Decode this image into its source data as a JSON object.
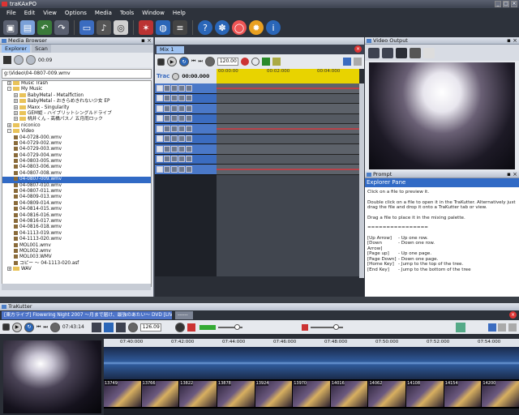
{
  "app": {
    "title": "traKAxPO"
  },
  "menu": [
    "File",
    "Edit",
    "View",
    "Options",
    "Media",
    "Tools",
    "Window",
    "Help"
  ],
  "media_browser": {
    "title": "Media Browser",
    "tabs": [
      "Explorer",
      "Scan"
    ],
    "time": "00:09",
    "path": "g:\\Video\\04-0807-009.wmv",
    "tree": [
      {
        "label": "Music Trash",
        "level": 1,
        "type": "folder",
        "expander": "+"
      },
      {
        "label": "My Music",
        "level": 1,
        "type": "folder",
        "expander": "-"
      },
      {
        "label": "BabyMetal - Metalfiction",
        "level": 2,
        "type": "folder",
        "expander": "+"
      },
      {
        "label": "BabyMetal - おきらめきれない少女 EP",
        "level": 2,
        "type": "folder",
        "expander": "+"
      },
      {
        "label": "Maxx - Singularity",
        "level": 2,
        "type": "folder",
        "expander": "+"
      },
      {
        "label": "GEM姫 - ハイブリットシングルドライブ",
        "level": 2,
        "type": "folder",
        "expander": "+"
      },
      {
        "label": "桃井くん - 高橋パスノ 五月雨ロック",
        "level": 2,
        "type": "folder",
        "expander": "+"
      },
      {
        "label": "niconico",
        "level": 1,
        "type": "folder",
        "expander": "+"
      },
      {
        "label": "Video",
        "level": 1,
        "type": "folder",
        "expander": "-"
      },
      {
        "label": "04-0728-000.wmv",
        "level": 2,
        "type": "file"
      },
      {
        "label": "04-0729-002.wmv",
        "level": 2,
        "type": "file"
      },
      {
        "label": "04-0729-003.wmv",
        "level": 2,
        "type": "file"
      },
      {
        "label": "04-0729-004.wmv",
        "level": 2,
        "type": "file"
      },
      {
        "label": "04-0803-005.wmv",
        "level": 2,
        "type": "file"
      },
      {
        "label": "04-0803-006.wmv",
        "level": 2,
        "type": "file"
      },
      {
        "label": "04-0807-008.wmv",
        "level": 2,
        "type": "file"
      },
      {
        "label": "04-0807-009.wmv",
        "level": 2,
        "type": "file",
        "selected": true
      },
      {
        "label": "04-0807-010.wmv",
        "level": 2,
        "type": "file"
      },
      {
        "label": "04-0807-011.wmv",
        "level": 2,
        "type": "file"
      },
      {
        "label": "04-0809-013.wmv",
        "level": 2,
        "type": "file"
      },
      {
        "label": "04-0809-014.wmv",
        "level": 2,
        "type": "file"
      },
      {
        "label": "04-0814-015.wmv",
        "level": 2,
        "type": "file"
      },
      {
        "label": "04-0816-016.wmv",
        "level": 2,
        "type": "file"
      },
      {
        "label": "04-0816-017.wmv",
        "level": 2,
        "type": "file"
      },
      {
        "label": "04-0816-018.wmv",
        "level": 2,
        "type": "file"
      },
      {
        "label": "04-1113-019.wmv",
        "level": 2,
        "type": "file"
      },
      {
        "label": "04-1113-020.wmv",
        "level": 2,
        "type": "file"
      },
      {
        "label": "MOL001.wmv",
        "level": 2,
        "type": "file"
      },
      {
        "label": "MOL002.wmv",
        "level": 2,
        "type": "file"
      },
      {
        "label": "MOL003.WMV",
        "level": 2,
        "type": "file"
      },
      {
        "label": "コピー ～ 04-1113-020.asf",
        "level": 2,
        "type": "file"
      },
      {
        "label": "WAV",
        "level": 1,
        "type": "folder",
        "expander": "+"
      }
    ]
  },
  "mixer": {
    "tab": "Mix 1",
    "bpm": "120.00",
    "track_label": "Trac",
    "time": "00:00.000",
    "ruler": [
      "00:00:00",
      "00:02:000",
      "00:04:000"
    ]
  },
  "video_output": {
    "title": "Video Output"
  },
  "prompt": {
    "title": "Prompt",
    "heading": "Explorer Pane",
    "p1": "Click on a file to preview it.",
    "p2": "Double click on a file to open it in the TraKutter. Alternatively just drag the file and drop it onto a TraKutter tab or view.",
    "p3": "Drag a file to place it in the mixing palette.",
    "divider": "================",
    "keys": [
      {
        "key": "[Up Arrow]",
        "desc": "- Up one row."
      },
      {
        "key": "[Down Arrow]",
        "desc": "- Down one row."
      },
      {
        "key": "[Page up]",
        "desc": "- Up one page."
      },
      {
        "key": "[Page Down]",
        "desc": "- Down one page."
      },
      {
        "key": "[Home Key]",
        "desc": "- Jump to the top of the tree."
      },
      {
        "key": "[End Key]",
        "desc": "- Jump to the bottom of the tree"
      }
    ]
  },
  "trakutter": {
    "title": "TraKutter",
    "tab1": "[東方ライブ] Flowering Night 2007 ～月まで届け、最強のあたい～ DVD [LIVE]",
    "tab2": "------",
    "time": "07:43:14",
    "bpm": "126.09",
    "ruler": [
      "07:40:000",
      "07:42:000",
      "07:44:000",
      "07:46:000",
      "07:48:000",
      "07:50:000",
      "07:52:000",
      "07:54:000"
    ],
    "frames": [
      "13749",
      "13766",
      "13822",
      "13878",
      "13924",
      "13970",
      "14016",
      "14062",
      "14108",
      "14154",
      "14200"
    ]
  }
}
